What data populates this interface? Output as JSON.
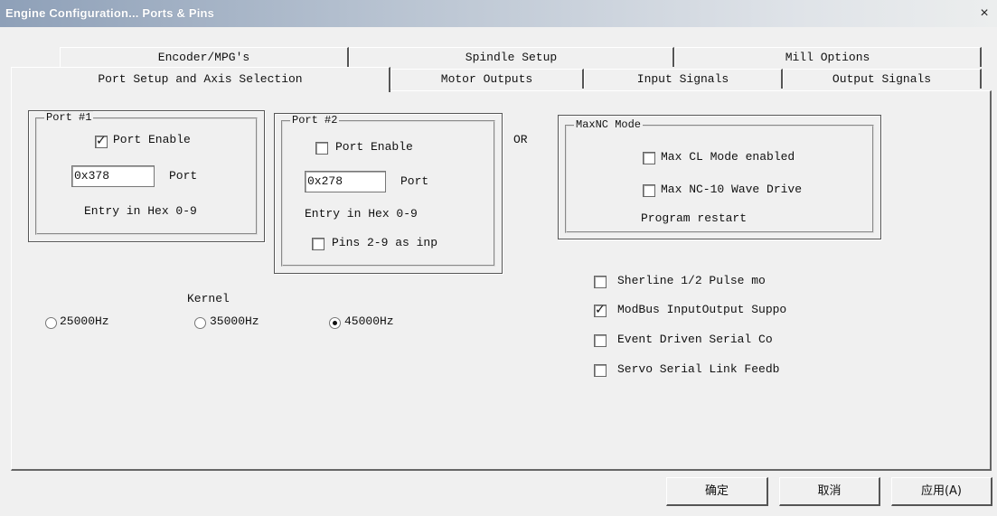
{
  "window": {
    "title": "Engine Configuration... Ports & Pins",
    "close": "×"
  },
  "tabs_row1": [
    "Encoder/MPG's",
    "Spindle Setup",
    "Mill Options"
  ],
  "tabs_row2": [
    "Port Setup and Axis Selection",
    "Motor Outputs",
    "Input Signals",
    "Output Signals"
  ],
  "active_tab": "Port Setup and Axis Selection",
  "port1": {
    "legend": "Port #1",
    "enable_label": "Port Enable",
    "enable_checked": true,
    "address": "0x378",
    "port_label": "Port",
    "hint": "Entry in Hex 0-9"
  },
  "port2": {
    "legend": "Port #2",
    "enable_label": "Port Enable",
    "enable_checked": false,
    "address": "0x278",
    "port_label": "Port",
    "hint": "Entry in Hex 0-9",
    "pins_label": "Pins 2-9 as inp",
    "pins_checked": false
  },
  "or_label": "OR",
  "maxnc": {
    "legend": "MaxNC Mode",
    "cl_label": "Max CL Mode enabled",
    "cl_checked": false,
    "wave_label": "Max NC-10 Wave Drive",
    "wave_checked": false,
    "restart": "Program restart"
  },
  "kernel": {
    "label": "Kernel",
    "options": [
      "25000Hz",
      "35000Hz",
      "45000Hz"
    ],
    "selected": "45000Hz"
  },
  "options": [
    {
      "label": "Sherline 1/2 Pulse mo",
      "checked": false
    },
    {
      "label": "ModBus InputOutput Suppo",
      "checked": true
    },
    {
      "label": "Event Driven Serial Co",
      "checked": false
    },
    {
      "label": "Servo Serial Link Feedb",
      "checked": false
    }
  ],
  "buttons": {
    "ok": "确定",
    "cancel": "取消",
    "apply": "应用(A)"
  }
}
